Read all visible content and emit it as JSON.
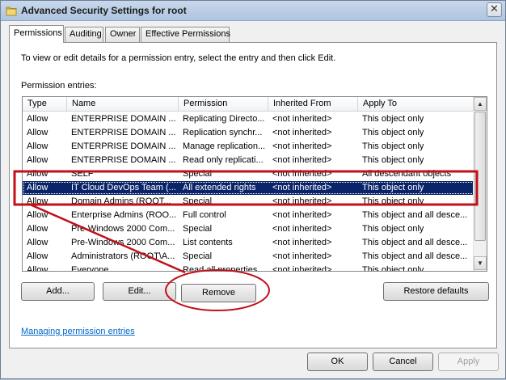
{
  "window": {
    "title": "Advanced Security Settings for root",
    "close_glyph": "✕"
  },
  "tabs": [
    {
      "label": "Permissions",
      "active": true
    },
    {
      "label": "Auditing",
      "active": false
    },
    {
      "label": "Owner",
      "active": false
    },
    {
      "label": "Effective Permissions",
      "active": false
    }
  ],
  "panel": {
    "instructions": "To view or edit details for a permission entry, select the entry and then click Edit.",
    "entries_label": "Permission entries:"
  },
  "columns": [
    "Type",
    "Name",
    "Permission",
    "Inherited From",
    "Apply To"
  ],
  "rows": [
    [
      "Allow",
      "ENTERPRISE DOMAIN ...",
      "Replicating Directo...",
      "<not inherited>",
      "This object only"
    ],
    [
      "Allow",
      "ENTERPRISE DOMAIN ...",
      "Replication synchr...",
      "<not inherited>",
      "This object only"
    ],
    [
      "Allow",
      "ENTERPRISE DOMAIN ...",
      "Manage replication...",
      "<not inherited>",
      "This object only"
    ],
    [
      "Allow",
      "ENTERPRISE DOMAIN ...",
      "Read only replicati...",
      "<not inherited>",
      "This object only"
    ],
    [
      "Allow",
      "SELF",
      "Special",
      "<not inherited>",
      "All descendant objects"
    ],
    [
      "Allow",
      "IT Cloud DevOps Team (...",
      "All extended rights",
      "<not inherited>",
      "This object only"
    ],
    [
      "Allow",
      "Domain Admins (ROOT...",
      "Special",
      "<not inherited>",
      "This object only"
    ],
    [
      "Allow",
      "Enterprise Admins (ROO...",
      "Full control",
      "<not inherited>",
      "This object and all desce..."
    ],
    [
      "Allow",
      "Pre-Windows 2000 Com...",
      "Special",
      "<not inherited>",
      "This object only"
    ],
    [
      "Allow",
      "Pre-Windows 2000 Com...",
      "List contents",
      "<not inherited>",
      "This object and all desce..."
    ],
    [
      "Allow",
      "Administrators (ROOT\\A...",
      "Special",
      "<not inherited>",
      "This object and all desce..."
    ],
    [
      "Allow",
      "Everyone",
      "Read all properties",
      "<not inherited>",
      "This object only"
    ]
  ],
  "selected_row": 5,
  "buttons": {
    "add": "Add...",
    "edit": "Edit...",
    "remove": "Remove",
    "restore": "Restore defaults",
    "ok": "OK",
    "cancel": "Cancel",
    "apply": "Apply"
  },
  "link": "Managing permission entries",
  "colors": {
    "annotation": "#c0101a",
    "selection": "#0a246a",
    "link": "#0066cc"
  }
}
